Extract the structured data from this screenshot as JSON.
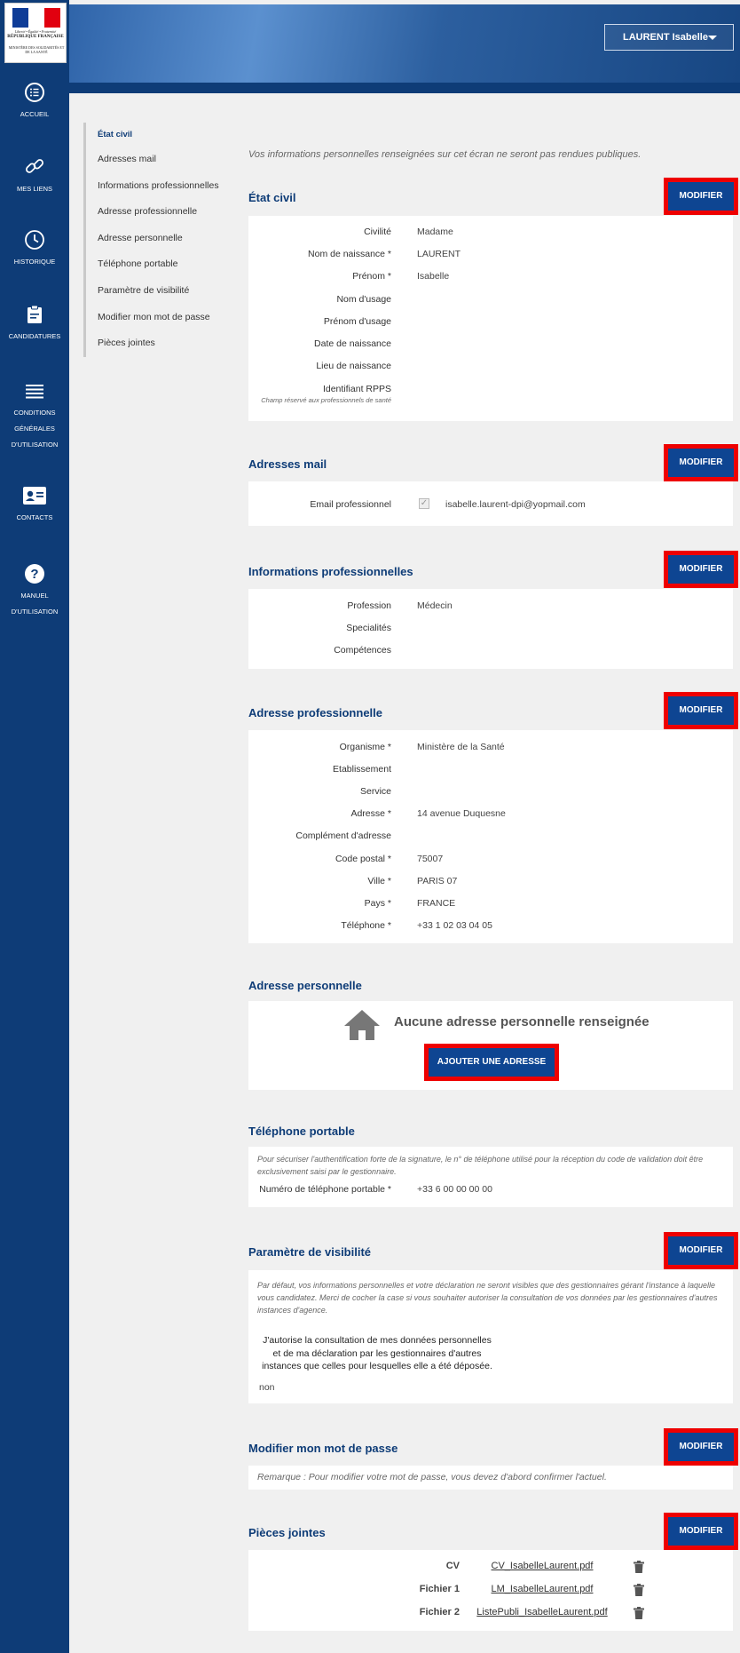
{
  "logo": {
    "motto": "Liberté • Égalité • Fraternité",
    "republic": "RÉPUBLIQUE FRANÇAISE",
    "ministry": "MINISTÈRE DES SOLIDARITÉS ET DE LA SANTÉ"
  },
  "sidebar": {
    "items": [
      {
        "label": "ACCUEIL",
        "icon": "list-circle-icon"
      },
      {
        "label": "MES LIENS",
        "icon": "link-icon"
      },
      {
        "label": "HISTORIQUE",
        "icon": "clock-icon"
      },
      {
        "label": "CANDIDATURES",
        "icon": "clipboard-icon"
      },
      {
        "label_lines": [
          "CONDITIONS",
          "GÉNÉRALES",
          "D'UTILISATION"
        ],
        "icon": "menu-lines-icon"
      },
      {
        "label": "CONTACTS",
        "icon": "contact-card-icon"
      },
      {
        "label_lines": [
          "MANUEL",
          "D'UTILISATION"
        ],
        "icon": "help-icon"
      }
    ]
  },
  "header": {
    "user_name": "LAURENT Isabelle"
  },
  "side_nav": [
    "État civil",
    "Adresses mail",
    "Informations professionnelles",
    "Adresse professionnelle",
    "Adresse personnelle",
    "Téléphone portable",
    "Paramètre de visibilité",
    "Modifier mon mot de passe",
    "Pièces jointes"
  ],
  "notice": "Vos informations personnelles renseignées sur cet écran ne seront pas rendues publiques.",
  "modify_label": "MODIFIER",
  "etat_civil": {
    "title": "État civil",
    "rows": [
      {
        "label": "Civilité",
        "value": "Madame"
      },
      {
        "label": "Nom de naissance *",
        "value": "LAURENT"
      },
      {
        "label": "Prénom *",
        "value": "Isabelle"
      },
      {
        "label": "Nom d'usage",
        "value": ""
      },
      {
        "label": "Prénom d'usage",
        "value": ""
      },
      {
        "label": "Date de naissance",
        "value": ""
      },
      {
        "label": "Lieu de naissance",
        "value": ""
      },
      {
        "label": "Identifiant RPPS",
        "value": "",
        "hint": "Champ réservé aux professionnels de santé"
      }
    ]
  },
  "adresses_mail": {
    "title": "Adresses mail",
    "label": "Email professionnel",
    "value": "isabelle.laurent-dpi@yopmail.com"
  },
  "infos_pro": {
    "title": "Informations professionnelles",
    "rows": [
      {
        "label": "Profession",
        "value": "Médecin"
      },
      {
        "label": "Specialités",
        "value": ""
      },
      {
        "label": "Compétences",
        "value": ""
      }
    ]
  },
  "adresse_pro": {
    "title": "Adresse professionnelle",
    "rows": [
      {
        "label": "Organisme *",
        "value": "Ministère de la Santé"
      },
      {
        "label": "Etablissement",
        "value": ""
      },
      {
        "label": "Service",
        "value": ""
      },
      {
        "label": "Adresse *",
        "value": "14 avenue Duquesne"
      },
      {
        "label": "Complément d'adresse",
        "value": ""
      },
      {
        "label": "Code postal *",
        "value": "75007"
      },
      {
        "label": "Ville *",
        "value": "PARIS 07"
      },
      {
        "label": "Pays *",
        "value": "FRANCE"
      },
      {
        "label": "Téléphone *",
        "value": "+33 1 02 03 04 05"
      }
    ]
  },
  "adresse_perso": {
    "title": "Adresse personnelle",
    "empty": "Aucune adresse personnelle renseignée",
    "add_label": "AJOUTER UNE ADRESSE"
  },
  "telephone": {
    "title": "Téléphone portable",
    "info": "Pour sécuriser l'authentification forte de la signature, le n° de téléphone utilisé pour la réception du code de validation doit être exclusivement saisi par le gestionnaire.",
    "label": "Numéro de téléphone portable *",
    "value": "+33 6 00 00 00 00"
  },
  "visibilite": {
    "title": "Paramètre de visibilité",
    "info": "Par défaut, vos informations personnelles et votre déclaration ne seront visibles que des gestionnaires gérant l'instance à laquelle vous candidatez. Merci de cocher la case si vous souhaiter autoriser la consultation de vos données par les gestionnaires d'autres instances d'agence.",
    "consent_lines": [
      "J'autorise la consultation de mes données personnelles",
      "et de ma déclaration par les gestionnaires d'autres",
      "instances que celles pour lesquelles elle a été déposée."
    ],
    "value": "non"
  },
  "mot_de_passe": {
    "title": "Modifier mon mot de passe",
    "info": "Remarque : Pour modifier votre mot de passe, vous devez d'abord confirmer l'actuel."
  },
  "pieces": {
    "title": "Pièces jointes",
    "files": [
      {
        "label": "CV",
        "file": "CV_IsabelleLaurent.pdf"
      },
      {
        "label": "Fichier 1",
        "file": "LM_IsabelleLaurent.pdf"
      },
      {
        "label": "Fichier 2",
        "file": "ListePubli_IsabelleLaurent.pdf"
      }
    ]
  }
}
